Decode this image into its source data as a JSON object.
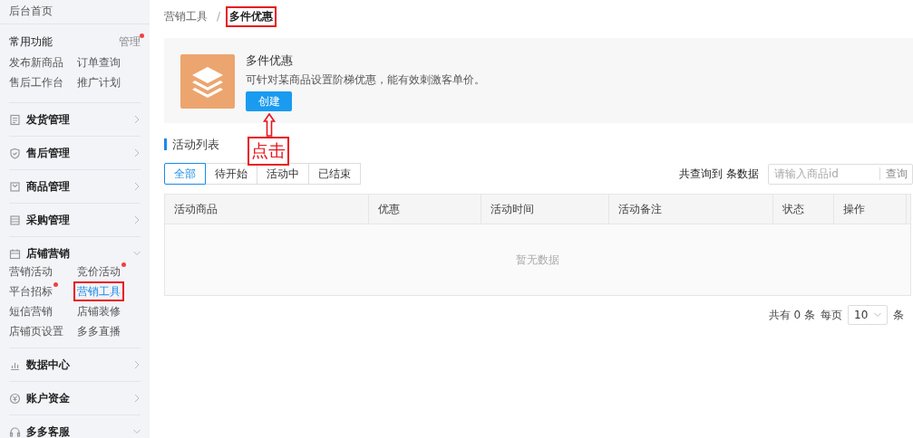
{
  "sidebar": {
    "home": "后台首页",
    "common": {
      "title": "常用功能",
      "manage": "管理",
      "manage_dot": true,
      "links": [
        {
          "label": "发布新商品",
          "dot": false,
          "selected": false,
          "annotated": false
        },
        {
          "label": "订单查询",
          "dot": false,
          "selected": false,
          "annotated": false
        },
        {
          "label": "售后工作台",
          "dot": false,
          "selected": false,
          "annotated": false
        },
        {
          "label": "推广计划",
          "dot": false,
          "selected": false,
          "annotated": false
        }
      ]
    },
    "sections": [
      {
        "label": "发货管理",
        "expanded": false
      },
      {
        "label": "售后管理",
        "expanded": false
      },
      {
        "label": "商品管理",
        "expanded": false
      },
      {
        "label": "采购管理",
        "expanded": false
      },
      {
        "label": "店铺营销",
        "expanded": true,
        "children": [
          {
            "label": "营销活动",
            "dot": false,
            "selected": false,
            "annotated": false
          },
          {
            "label": "竞价活动",
            "dot": true,
            "selected": false,
            "annotated": false
          },
          {
            "label": "平台招标",
            "dot": true,
            "selected": false,
            "annotated": false
          },
          {
            "label": "营销工具",
            "dot": false,
            "selected": true,
            "annotated": true
          },
          {
            "label": "短信营销",
            "dot": false,
            "selected": false,
            "annotated": false
          },
          {
            "label": "店铺装修",
            "dot": false,
            "selected": false,
            "annotated": false
          },
          {
            "label": "店铺页设置",
            "dot": false,
            "selected": false,
            "annotated": false
          },
          {
            "label": "多多直播",
            "dot": false,
            "selected": false,
            "annotated": false
          }
        ]
      },
      {
        "label": "数据中心",
        "expanded": false
      },
      {
        "label": "账户资金",
        "expanded": false
      },
      {
        "label": "多多客服",
        "expanded": true
      }
    ]
  },
  "breadcrumb": {
    "separator": "/",
    "items": [
      {
        "label": "营销工具",
        "current": false,
        "annotated": false
      },
      {
        "label": "多件优惠",
        "current": true,
        "annotated": true
      }
    ]
  },
  "promo": {
    "title": "多件优惠",
    "description": "可针对某商品设置阶梯优惠，能有效刺激客单价。",
    "button": "创建",
    "annotation": "点击"
  },
  "list": {
    "title": "活动列表",
    "tabs": [
      {
        "label": "全部",
        "selected": true
      },
      {
        "label": "待开始",
        "selected": false
      },
      {
        "label": "活动中",
        "selected": false
      },
      {
        "label": "已结束",
        "selected": false
      }
    ],
    "result_text": "共查询到 条数据",
    "search": {
      "placeholder": "请输入商品id",
      "button": "查询"
    },
    "table": {
      "columns": [
        "活动商品",
        "优惠",
        "活动时间",
        "活动备注",
        "状态",
        "操作"
      ],
      "empty": "暂无数据"
    },
    "pagination": {
      "total": "共有 0 条",
      "per_page_label": "每页",
      "per_page": "10",
      "unit": "条"
    }
  }
}
